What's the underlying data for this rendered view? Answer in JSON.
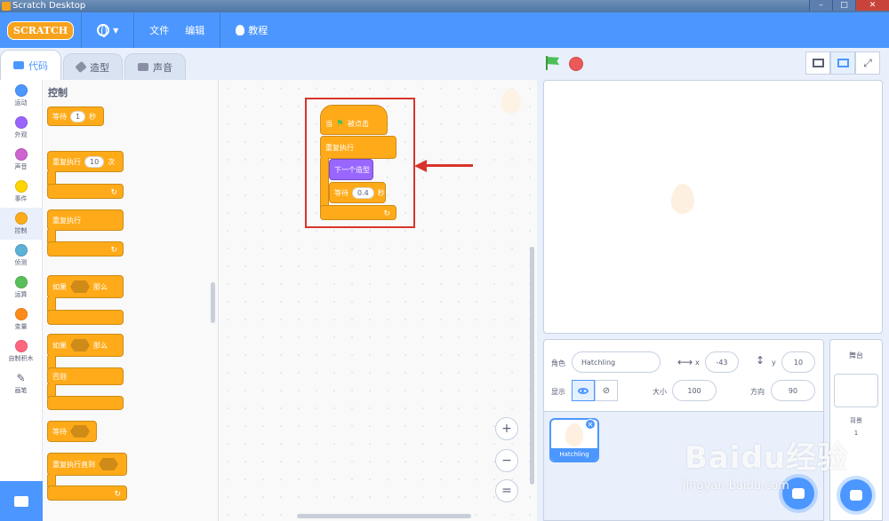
{
  "window": {
    "title": "Scratch Desktop"
  },
  "menubar": {
    "logo": "SCRATCH",
    "file": "文件",
    "edit": "编辑",
    "tutorials": "教程"
  },
  "tabs": [
    {
      "label": "代码"
    },
    {
      "label": "造型"
    },
    {
      "label": "声音"
    }
  ],
  "categories": [
    {
      "label": "运动",
      "color": "#4c97ff"
    },
    {
      "label": "外观",
      "color": "#9966ff"
    },
    {
      "label": "声音",
      "color": "#cf63cf"
    },
    {
      "label": "事件",
      "color": "#ffd500"
    },
    {
      "label": "控制",
      "color": "#ffab19"
    },
    {
      "label": "侦测",
      "color": "#5cb1d6"
    },
    {
      "label": "运算",
      "color": "#59c059"
    },
    {
      "label": "变量",
      "color": "#ff8c1a"
    },
    {
      "label": "自制积木",
      "color": "#ff6680"
    },
    {
      "label": "画笔",
      "color": "#0fbd8c"
    }
  ],
  "palette": {
    "title": "控制",
    "wait": {
      "label": "等待",
      "value": "1",
      "unit": "秒"
    },
    "repeat": {
      "label": "重复执行",
      "value": "10",
      "unit": "次"
    },
    "forever": {
      "label": "重复执行"
    },
    "if_then": {
      "label": "如果",
      "then": "那么"
    },
    "if_else": {
      "label": "如果",
      "then": "那么",
      "else": "否则"
    },
    "wait_until": {
      "label": "等待"
    },
    "repeat_until": {
      "label": "重复执行直到"
    }
  },
  "script": {
    "hat": {
      "label": "当",
      "clicked": "被点击"
    },
    "forever": {
      "label": "重复执行"
    },
    "next_costume": {
      "label": "下一个造型"
    },
    "wait": {
      "label": "等待",
      "value": "0.4",
      "unit": "秒"
    }
  },
  "zoom": {
    "in": "+",
    "out": "−",
    "reset": "="
  },
  "sprite": {
    "label": "角色",
    "name": "Hatchling",
    "x_label": "x",
    "x": "-43",
    "y_label": "y",
    "y": "10",
    "show_label": "显示",
    "size_label": "大小",
    "size": "100",
    "direction_label": "方向",
    "direction": "90"
  },
  "sprite_list": [
    {
      "name": "Hatchling"
    }
  ],
  "stage_pane": {
    "title": "舞台",
    "backdrop_label": "背景",
    "backdrop_count": "1"
  },
  "watermark": {
    "brand": "Baidu经验",
    "url": "jingyan.baidu.com"
  }
}
